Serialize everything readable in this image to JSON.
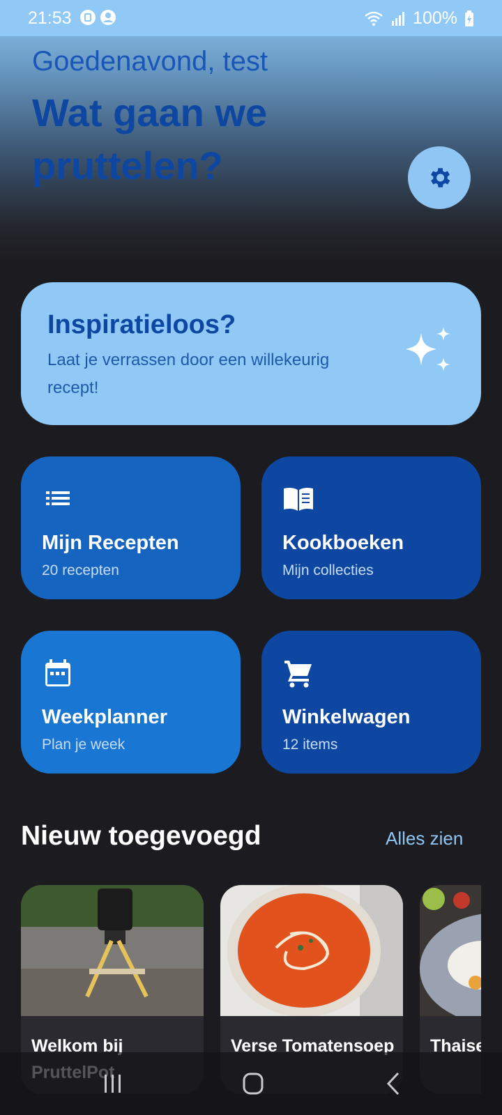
{
  "status_bar": {
    "time": "21:53",
    "battery": "100%"
  },
  "header": {
    "greeting": "Goedenavond, test",
    "headline": "Wat gaan we pruttelen?"
  },
  "inspiration": {
    "title": "Inspiratieloos?",
    "subtitle": "Laat je verrassen door een willekeurig recept!"
  },
  "tiles": [
    {
      "title": "Mijn Recepten",
      "subtitle": "20 recepten",
      "icon": "list-icon",
      "color": "#1565c0"
    },
    {
      "title": "Kookboeken",
      "subtitle": "Mijn collecties",
      "icon": "book-open-icon",
      "color": "#0d47a1"
    },
    {
      "title": "Weekplanner",
      "subtitle": "Plan je week",
      "icon": "calendar-icon",
      "color": "#1976d2"
    },
    {
      "title": "Winkelwagen",
      "subtitle": "12 items",
      "icon": "cart-icon",
      "color": "#0d47a1"
    }
  ],
  "recent": {
    "title": "Nieuw toegevoegd",
    "see_all": "Alles zien",
    "cards": [
      {
        "title": "Welkom bij PruttelPot"
      },
      {
        "title": "Verse Tomatensoep"
      },
      {
        "title": "Thaise ... met ki..."
      }
    ]
  },
  "colors": {
    "accent_light": "#90c8f6",
    "accent_dark": "#0d47a1",
    "background": "#1c1b1f"
  }
}
